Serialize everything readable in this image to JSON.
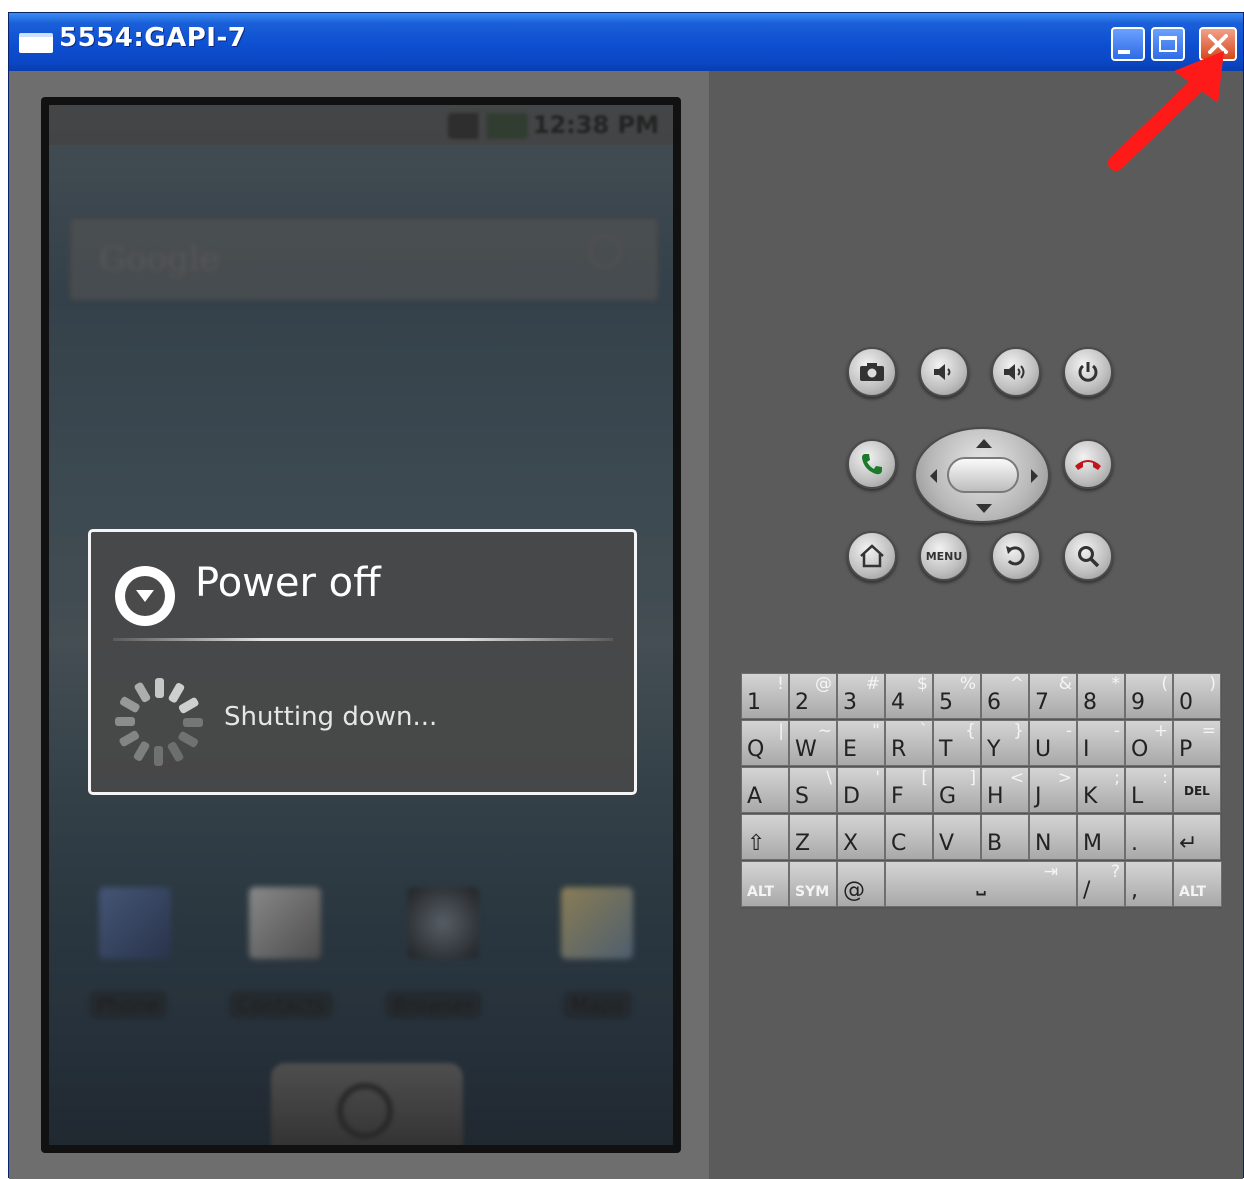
{
  "window": {
    "title": "5554:GAPI-7",
    "buttons": {
      "minimize": "minimize-button",
      "maximize": "maximize-button",
      "close": "close-button"
    }
  },
  "annotation": {
    "color": "#ff1a1a",
    "icon": "red-arrow-icon"
  },
  "phone": {
    "status_time": "12:38 PM",
    "search_placeholder": "Google",
    "apps": [
      "Phone",
      "Contacts",
      "Browser",
      "Maps"
    ]
  },
  "dialog": {
    "title": "Power off",
    "message": "Shutting down..."
  },
  "controls": {
    "row1": [
      "camera-icon",
      "volume-down-icon",
      "volume-up-icon",
      "power-icon"
    ],
    "row2": [
      "call-icon",
      "dpad",
      "end-call-icon"
    ],
    "row3": [
      "home-icon",
      "menu-button",
      "back-icon",
      "search-icon"
    ],
    "menu_label": "MENU"
  },
  "keyboard": {
    "rows": [
      [
        {
          "k": "1",
          "a": "!"
        },
        {
          "k": "2",
          "a": "@"
        },
        {
          "k": "3",
          "a": "#"
        },
        {
          "k": "4",
          "a": "$"
        },
        {
          "k": "5",
          "a": "%"
        },
        {
          "k": "6",
          "a": "^"
        },
        {
          "k": "7",
          "a": "&"
        },
        {
          "k": "8",
          "a": "*"
        },
        {
          "k": "9",
          "a": "("
        },
        {
          "k": "0",
          "a": ")"
        }
      ],
      [
        {
          "k": "Q",
          "a": "|"
        },
        {
          "k": "W",
          "a": "~"
        },
        {
          "k": "E",
          "a": "\""
        },
        {
          "k": "R",
          "a": "`"
        },
        {
          "k": "T",
          "a": "{"
        },
        {
          "k": "Y",
          "a": "}"
        },
        {
          "k": "U",
          "a": "-"
        },
        {
          "k": "I",
          "a": "-"
        },
        {
          "k": "O",
          "a": "+"
        },
        {
          "k": "P",
          "a": "="
        }
      ],
      [
        {
          "k": "A",
          "a": ""
        },
        {
          "k": "S",
          "a": "\\"
        },
        {
          "k": "D",
          "a": "'"
        },
        {
          "k": "F",
          "a": "["
        },
        {
          "k": "G",
          "a": "]"
        },
        {
          "k": "H",
          "a": "<"
        },
        {
          "k": "J",
          "a": ">"
        },
        {
          "k": "K",
          "a": ";"
        },
        {
          "k": "L",
          "a": ":"
        },
        {
          "k": "DEL",
          "a": ""
        }
      ],
      [
        {
          "k": "⇧",
          "a": ""
        },
        {
          "k": "Z",
          "a": ""
        },
        {
          "k": "X",
          "a": ""
        },
        {
          "k": "C",
          "a": ""
        },
        {
          "k": "V",
          "a": ""
        },
        {
          "k": "B",
          "a": ""
        },
        {
          "k": "N",
          "a": ""
        },
        {
          "k": "M",
          "a": ""
        },
        {
          "k": ".",
          "a": ""
        },
        {
          "k": "↵",
          "a": ""
        }
      ]
    ],
    "bottom_row": {
      "alt_left": "ALT",
      "sym": "SYM",
      "at": "@",
      "space": "⎵",
      "tab": "⇥",
      "slash": "/",
      "question": "?",
      "comma": ",",
      "alt_right": "ALT"
    }
  }
}
